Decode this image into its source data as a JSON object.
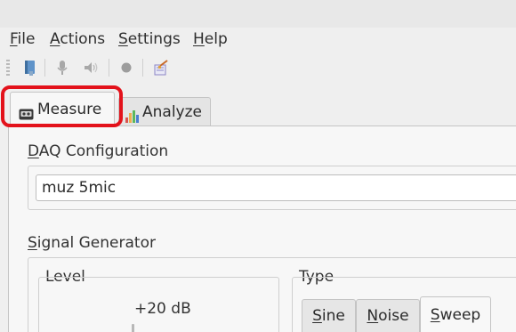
{
  "menu": {
    "file": {
      "mnemonic": "F",
      "rest": "ile"
    },
    "actions": {
      "mnemonic": "A",
      "rest": "ctions"
    },
    "settings": {
      "mnemonic": "S",
      "rest": "ettings"
    },
    "help": {
      "mnemonic": "H",
      "rest": "elp"
    }
  },
  "toolbar": {
    "icons": [
      "book-icon",
      "microphone-icon",
      "speaker-icon",
      "record-icon",
      "clear-icon"
    ]
  },
  "tabs": {
    "measure": {
      "label": "Measure",
      "icon": "tape-icon"
    },
    "analyze": {
      "label": "Analyze",
      "icon": "bar-chart-icon"
    }
  },
  "daq": {
    "title_mnemonic": "D",
    "title_rest": "AQ Configuration",
    "value": "muz 5mic"
  },
  "signal_generator": {
    "title_mnemonic": "S",
    "title_rest": "ignal Generator",
    "level_title": "Level",
    "level_value": "+20 dB",
    "type_title": "Type",
    "type_tabs": [
      {
        "mnemonic": "S",
        "rest": "ine"
      },
      {
        "mnemonic": "N",
        "rest": "oise"
      },
      {
        "mnemonic": "S",
        "rest": "weep"
      }
    ],
    "selected_type": "Sweep"
  },
  "colors": {
    "focus_ring": "#e3121b",
    "window_bg": "#efefef",
    "panel_bg": "#f7f7f7"
  }
}
